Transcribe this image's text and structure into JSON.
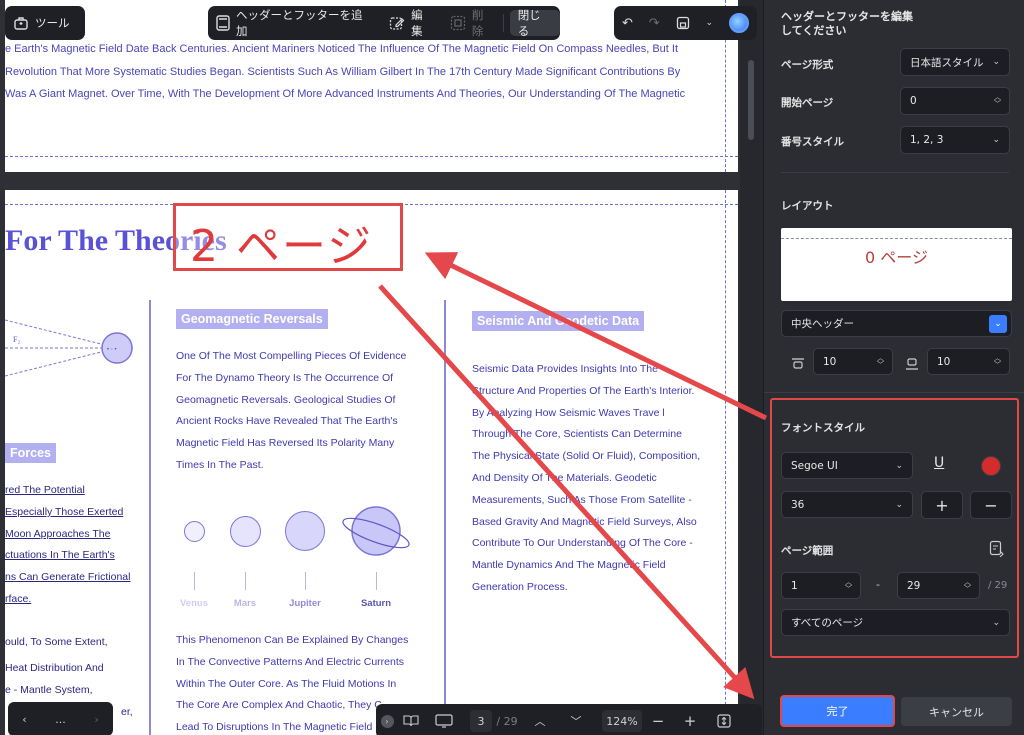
{
  "toolbar": {
    "tools_label": "ツール",
    "add_header_footer_label": "ヘッダーとフッターを追加",
    "edit_label": "編集",
    "delete_label": "削除",
    "close_label": "閉じる"
  },
  "page1": {
    "lines": [
      "e Earth's Magnetic Field Date Back Centuries. Ancient Mariners Noticed The Influence Of The Magnetic Field On Compass Needles, But It",
      "Revolution That More Systematic Studies Began. Scientists Such As William Gilbert In The 17th Century Made Significant Contributions By",
      "Was A Giant Magnet. Over Time, With The Development Of More Advanced Instruments And Theories, Our Understanding Of The Magnetic"
    ]
  },
  "page2": {
    "title": "For The Theories",
    "annotation": "2 ページ",
    "diagram_label": "F₂",
    "forces_heading": "Forces",
    "forces_lines": [
      "red The Potential",
      "Especially Those Exerted",
      "Moon Approaches The",
      "ctuations In The Earth's",
      "ns Can Generate Frictional",
      "rface."
    ],
    "left_bottom_lines": [
      "ould, To Some Extent,",
      "Heat Distribution And",
      "e - Mantle System,",
      "er,"
    ],
    "geomag_heading": "Geomagnetic Reversals",
    "geomag_lines": [
      "One Of The Most Compelling Pieces Of Evidence",
      "For The Dynamo Theory Is The Occurrence Of",
      "Geomagnetic Reversals. Geological Studies Of",
      "Ancient Rocks Have Revealed That The Earth's",
      "Magnetic Field Has Reversed Its Polarity Many",
      "Times In The Past."
    ],
    "planets": [
      "Venus",
      "Mars",
      "Jupiter",
      "Saturn"
    ],
    "phenomenon_lines": [
      "This Phenomenon Can Be Explained By Changes",
      "In The Convective Patterns And Electric Currents",
      "Within The Outer Core. As The Fluid Motions In",
      "The Core Are Complex And Chaotic, They C",
      "Lead To Disruptions In The Magnetic Field"
    ],
    "seismic_heading": "Seismic And Geodetic Data",
    "seismic_lines": [
      "Seismic Data Provides Insights Into The",
      "Structure And Properties Of The Earth's Interior.",
      "By Analyzing How Seismic Waves Trave l",
      "Through The Core, Scientists Can Determine",
      "The Physical State (Solid Or Fluid), Composition,",
      "And Density Of The Materials. Geodetic",
      "Measurements, Such As Those From Satellite -",
      "Based Gravity And Magnetic Field Surveys, Also",
      "Contribute To Our Understanding Of The Core -",
      "Mantle Dynamics And The Magnetic Field",
      "Generation Process."
    ]
  },
  "bottom_nav": {
    "more_label": "..."
  },
  "bottom_bar": {
    "current_page": "3",
    "total_pages": "/ 29",
    "zoom": "124%"
  },
  "panel": {
    "title": "ヘッダーとフッターを編集してください",
    "page_format_label": "ページ形式",
    "page_format_value": "日本語スタイル",
    "start_page_label": "開始ページ",
    "start_page_value": "0",
    "number_style_label": "番号スタイル",
    "number_style_value": "1, 2, 3",
    "layout_label": "レイアウト",
    "preview_text": "0 ページ",
    "position_value": "中央ヘッダー",
    "margin_top": "10",
    "margin_bottom": "10",
    "font_style_label": "フォントスタイル",
    "font_value": "Segoe UI",
    "font_size": "36",
    "font_color": "#d42b2b",
    "page_range_label": "ページ範囲",
    "range_start": "1",
    "range_dash": "-",
    "range_end": "29",
    "range_total": "/ 29",
    "range_scope": "すべてのページ",
    "ok_label": "完了",
    "cancel_label": "キャンセル"
  }
}
